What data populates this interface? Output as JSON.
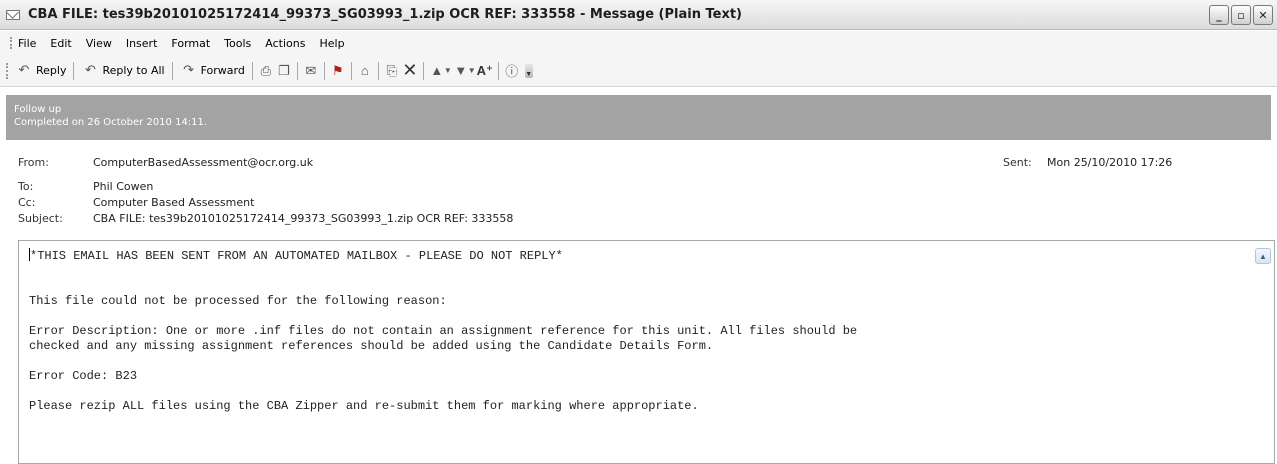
{
  "window": {
    "title": "CBA FILE: tes39b20101025172414_99373_SG03993_1.zip OCR REF: 333558 - Message (Plain Text)",
    "controls": [
      "_",
      "▫",
      "✕"
    ]
  },
  "menu": [
    "File",
    "Edit",
    "View",
    "Insert",
    "Format",
    "Tools",
    "Actions",
    "Help"
  ],
  "toolbar": {
    "reply": "Reply",
    "reply_all": "Reply to All",
    "forward": "Forward",
    "icons": [
      "print-icon",
      "copy-icon",
      "move-to-folder-icon",
      "flag-icon",
      "mark-unread-icon",
      "find-icon",
      "delete-icon",
      "previous-item-icon",
      "next-item-icon",
      "font-size-icon",
      "help-icon"
    ]
  },
  "followup": {
    "line1": "Follow up",
    "line2": "Completed on 26 October 2010 14:11."
  },
  "headers": {
    "from_label": "From:",
    "from": "ComputerBasedAssessment@ocr.org.uk",
    "sent_label": "Sent:",
    "sent": "Mon 25/10/2010 17:26",
    "to_label": "To:",
    "to": "Phil Cowen",
    "cc_label": "Cc:",
    "cc": "Computer Based Assessment",
    "subject_label": "Subject:",
    "subject": "CBA FILE: tes39b20101025172414_99373_SG03993_1.zip OCR REF: 333558"
  },
  "body": {
    "line1": "*THIS EMAIL HAS BEEN SENT FROM AN AUTOMATED MAILBOX - PLEASE DO NOT REPLY*",
    "line2": "This file could not be processed for the following reason:",
    "line3": "Error Description: One or more .inf files do not contain an assignment reference for this unit. All files should be",
    "line4": "checked and any missing assignment references should be added using the Candidate Details Form.",
    "line5": "Error Code: B23",
    "line6": "Please rezip ALL files using the CBA Zipper and re-submit them for marking where appropriate."
  }
}
